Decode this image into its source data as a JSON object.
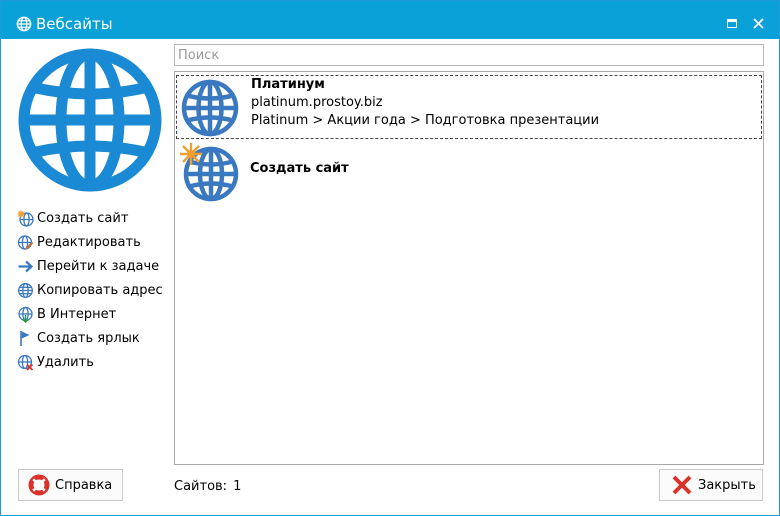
{
  "window": {
    "title": "Вебсайты"
  },
  "search": {
    "placeholder": "Поиск"
  },
  "actions": [
    {
      "label": "Создать сайт",
      "icon": "globe-new-icon"
    },
    {
      "label": "Редактировать",
      "icon": "globe-edit-icon"
    },
    {
      "label": "Перейти к задаче",
      "icon": "arrow-right-icon"
    },
    {
      "label": "Копировать адрес",
      "icon": "globe-copy-icon"
    },
    {
      "label": "В Интернет",
      "icon": "globe-download-icon"
    },
    {
      "label": "Создать ярлык",
      "icon": "flag-icon"
    },
    {
      "label": "Удалить",
      "icon": "globe-delete-icon"
    }
  ],
  "sites": [
    {
      "title": "Платинум",
      "url": "platinum.prostoy.biz",
      "path": "Platinum > Акции года > Подготовка презентации"
    }
  ],
  "create_item": {
    "title": "Создать сайт"
  },
  "footer": {
    "help_label": "Справка",
    "count_label": "Сайтов:",
    "count_value": "1",
    "close_label": "Закрыть"
  },
  "colors": {
    "titlebar": "#0aa0d8",
    "globe_large": "#1a8ad4",
    "globe_item": "#3a78bf",
    "close_x": "#d9322b"
  }
}
